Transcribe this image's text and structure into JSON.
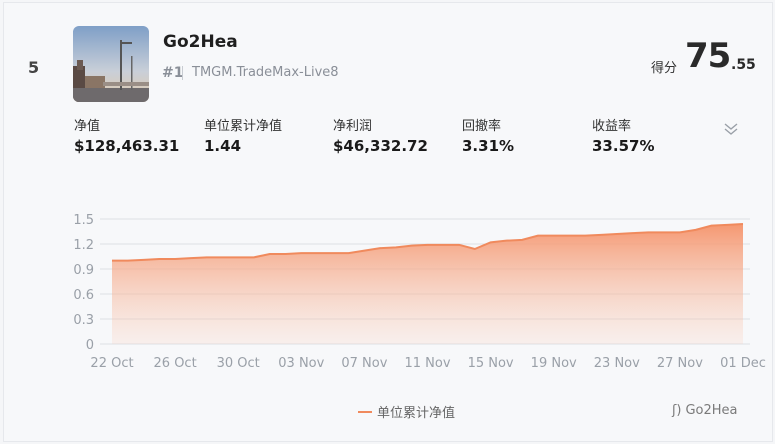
{
  "rank": "5",
  "trader": {
    "name": "Go2Hea",
    "account_rank": "#1",
    "account_name": "TMGM.TradeMax-Live8"
  },
  "score": {
    "label": "得分",
    "integer": "75",
    "decimal": ".55"
  },
  "stats": [
    {
      "label": "净值",
      "value": "$128,463.31"
    },
    {
      "label": "单位累计净值",
      "value": "1.44"
    },
    {
      "label": "净利润",
      "value": "$46,332.72"
    },
    {
      "label": "回撤率",
      "value": "3.31%"
    },
    {
      "label": "收益率",
      "value": "33.57%"
    }
  ],
  "icons": {
    "expand": "chevron-double-down-icon",
    "avatar": "avatar-photo"
  },
  "watermark": "Go2Hea",
  "chart_data": {
    "type": "area",
    "series": [
      {
        "name": "单位累计净值",
        "color": "#f08a5d",
        "x": [
          "2022-10-22",
          "2022-10-23",
          "2022-10-24",
          "2022-10-25",
          "2022-10-26",
          "2022-10-27",
          "2022-10-28",
          "2022-10-29",
          "2022-10-30",
          "2022-10-31",
          "2022-11-01",
          "2022-11-02",
          "2022-11-03",
          "2022-11-04",
          "2022-11-05",
          "2022-11-06",
          "2022-11-07",
          "2022-11-08",
          "2022-11-09",
          "2022-11-10",
          "2022-11-11",
          "2022-11-12",
          "2022-11-13",
          "2022-11-14",
          "2022-11-15",
          "2022-11-16",
          "2022-11-17",
          "2022-11-18",
          "2022-11-19",
          "2022-11-20",
          "2022-11-21",
          "2022-11-22",
          "2022-11-23",
          "2022-11-24",
          "2022-11-25",
          "2022-11-26",
          "2022-11-27",
          "2022-11-28",
          "2022-11-29",
          "2022-11-30",
          "2022-12-01"
        ],
        "values": [
          1.0,
          1.0,
          1.01,
          1.02,
          1.02,
          1.03,
          1.04,
          1.04,
          1.04,
          1.04,
          1.08,
          1.08,
          1.09,
          1.09,
          1.09,
          1.09,
          1.12,
          1.15,
          1.16,
          1.18,
          1.19,
          1.19,
          1.19,
          1.14,
          1.22,
          1.24,
          1.25,
          1.3,
          1.3,
          1.3,
          1.3,
          1.31,
          1.32,
          1.33,
          1.34,
          1.34,
          1.34,
          1.37,
          1.42,
          1.43,
          1.44
        ]
      }
    ],
    "x_ticks": [
      "22 Oct",
      "26 Oct",
      "30 Oct",
      "03 Nov",
      "07 Nov",
      "11 Nov",
      "15 Nov",
      "19 Nov",
      "23 Nov",
      "27 Nov",
      "01 Dec"
    ],
    "y_ticks": [
      "0",
      "0.3",
      "0.6",
      "0.9",
      "1.2",
      "1.5"
    ],
    "ylim": [
      0,
      1.5
    ],
    "grid": true,
    "legend": "bottom-center"
  }
}
